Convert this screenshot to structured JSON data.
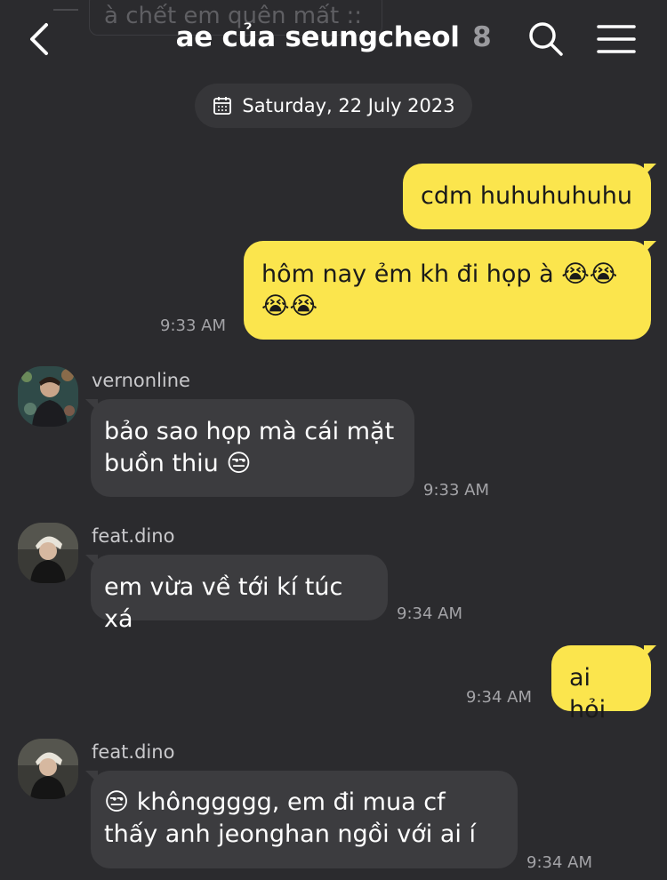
{
  "header": {
    "ghost_text": "à chết em quên mất ::",
    "title": "ae của seungcheol",
    "member_count": "8"
  },
  "date_pill": {
    "label": "Saturday, 22 July 2023"
  },
  "messages": [
    {
      "sender": "me",
      "text": "cdm huhuhuhuhu"
    },
    {
      "sender": "me",
      "text": "hôm nay ẻm kh đi họp à 😭😭😭😭",
      "time": "9:33 AM"
    },
    {
      "sender": "vernonline",
      "text": "bảo sao họp mà cái mặt buồn thiu 😒",
      "time": "9:33 AM"
    },
    {
      "sender": "feat.dino",
      "text": "em vừa về tới kí túc xá",
      "time": "9:34 AM"
    },
    {
      "sender": "me",
      "text": "ai hỏi",
      "time": "9:34 AM"
    },
    {
      "sender": "feat.dino",
      "text": "😒 khônggggg, em đi mua cf thấy anh jeonghan ngồi với ai í",
      "time": "9:34 AM"
    }
  ],
  "colors": {
    "background": "#2b2b2e",
    "my_bubble": "#fbe54d",
    "their_bubble": "#3c3c3f"
  }
}
